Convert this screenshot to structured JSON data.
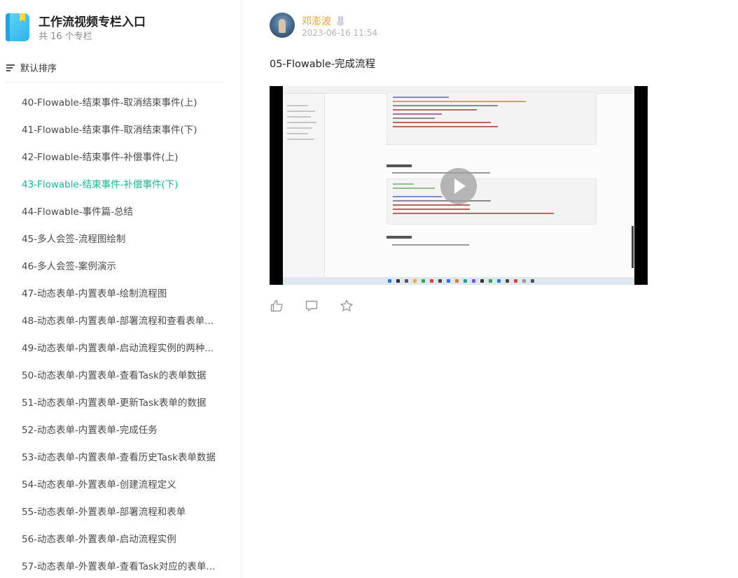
{
  "sidebar": {
    "title": "工作流视频专栏入口",
    "count_text": "共 16 个专栏",
    "sort_label": "默认排序",
    "active_index": 3,
    "items": [
      "40-Flowable-结束事件-取消结束事件(上)",
      "41-Flowable-结束事件-取消结束事件(下)",
      "42-Flowable-结束事件-补偿事件(上)",
      "43-Flowable-结束事件-补偿事件(下)",
      "44-Flowable-事件篇-总结",
      "45-多人会签-流程图绘制",
      "46-多人会签-案例演示",
      "47-动态表单-内置表单-绘制流程图",
      "48-动态表单-内置表单-部署流程和查看表单...",
      "49-动态表单-内置表单-启动流程实例的两种...",
      "50-动态表单-内置表单-查看Task的表单数据",
      "51-动态表单-内置表单-更新Task表单的数据",
      "52-动态表单-内置表单-完成任务",
      "53-动态表单-内置表单-查看历史Task表单数据",
      "54-动态表单-外置表单-创建流程定义",
      "55-动态表单-外置表单-部署流程和表单",
      "56-动态表单-外置表单-启动流程实例",
      "57-动态表单-外置表单-查看Task对应的表单..."
    ]
  },
  "post": {
    "author": "邓澎波",
    "date": "2023-06-16 11:54",
    "title": "05-Flowable-完成流程"
  },
  "colors": {
    "active_item": "#1cb394",
    "author": "#f0a52e",
    "date": "#b6b6b6"
  },
  "icons": {
    "sort": "sort-lines-icon",
    "like": "thumbs-up-icon",
    "comment": "comment-icon",
    "favorite": "star-icon",
    "play": "play-icon"
  }
}
